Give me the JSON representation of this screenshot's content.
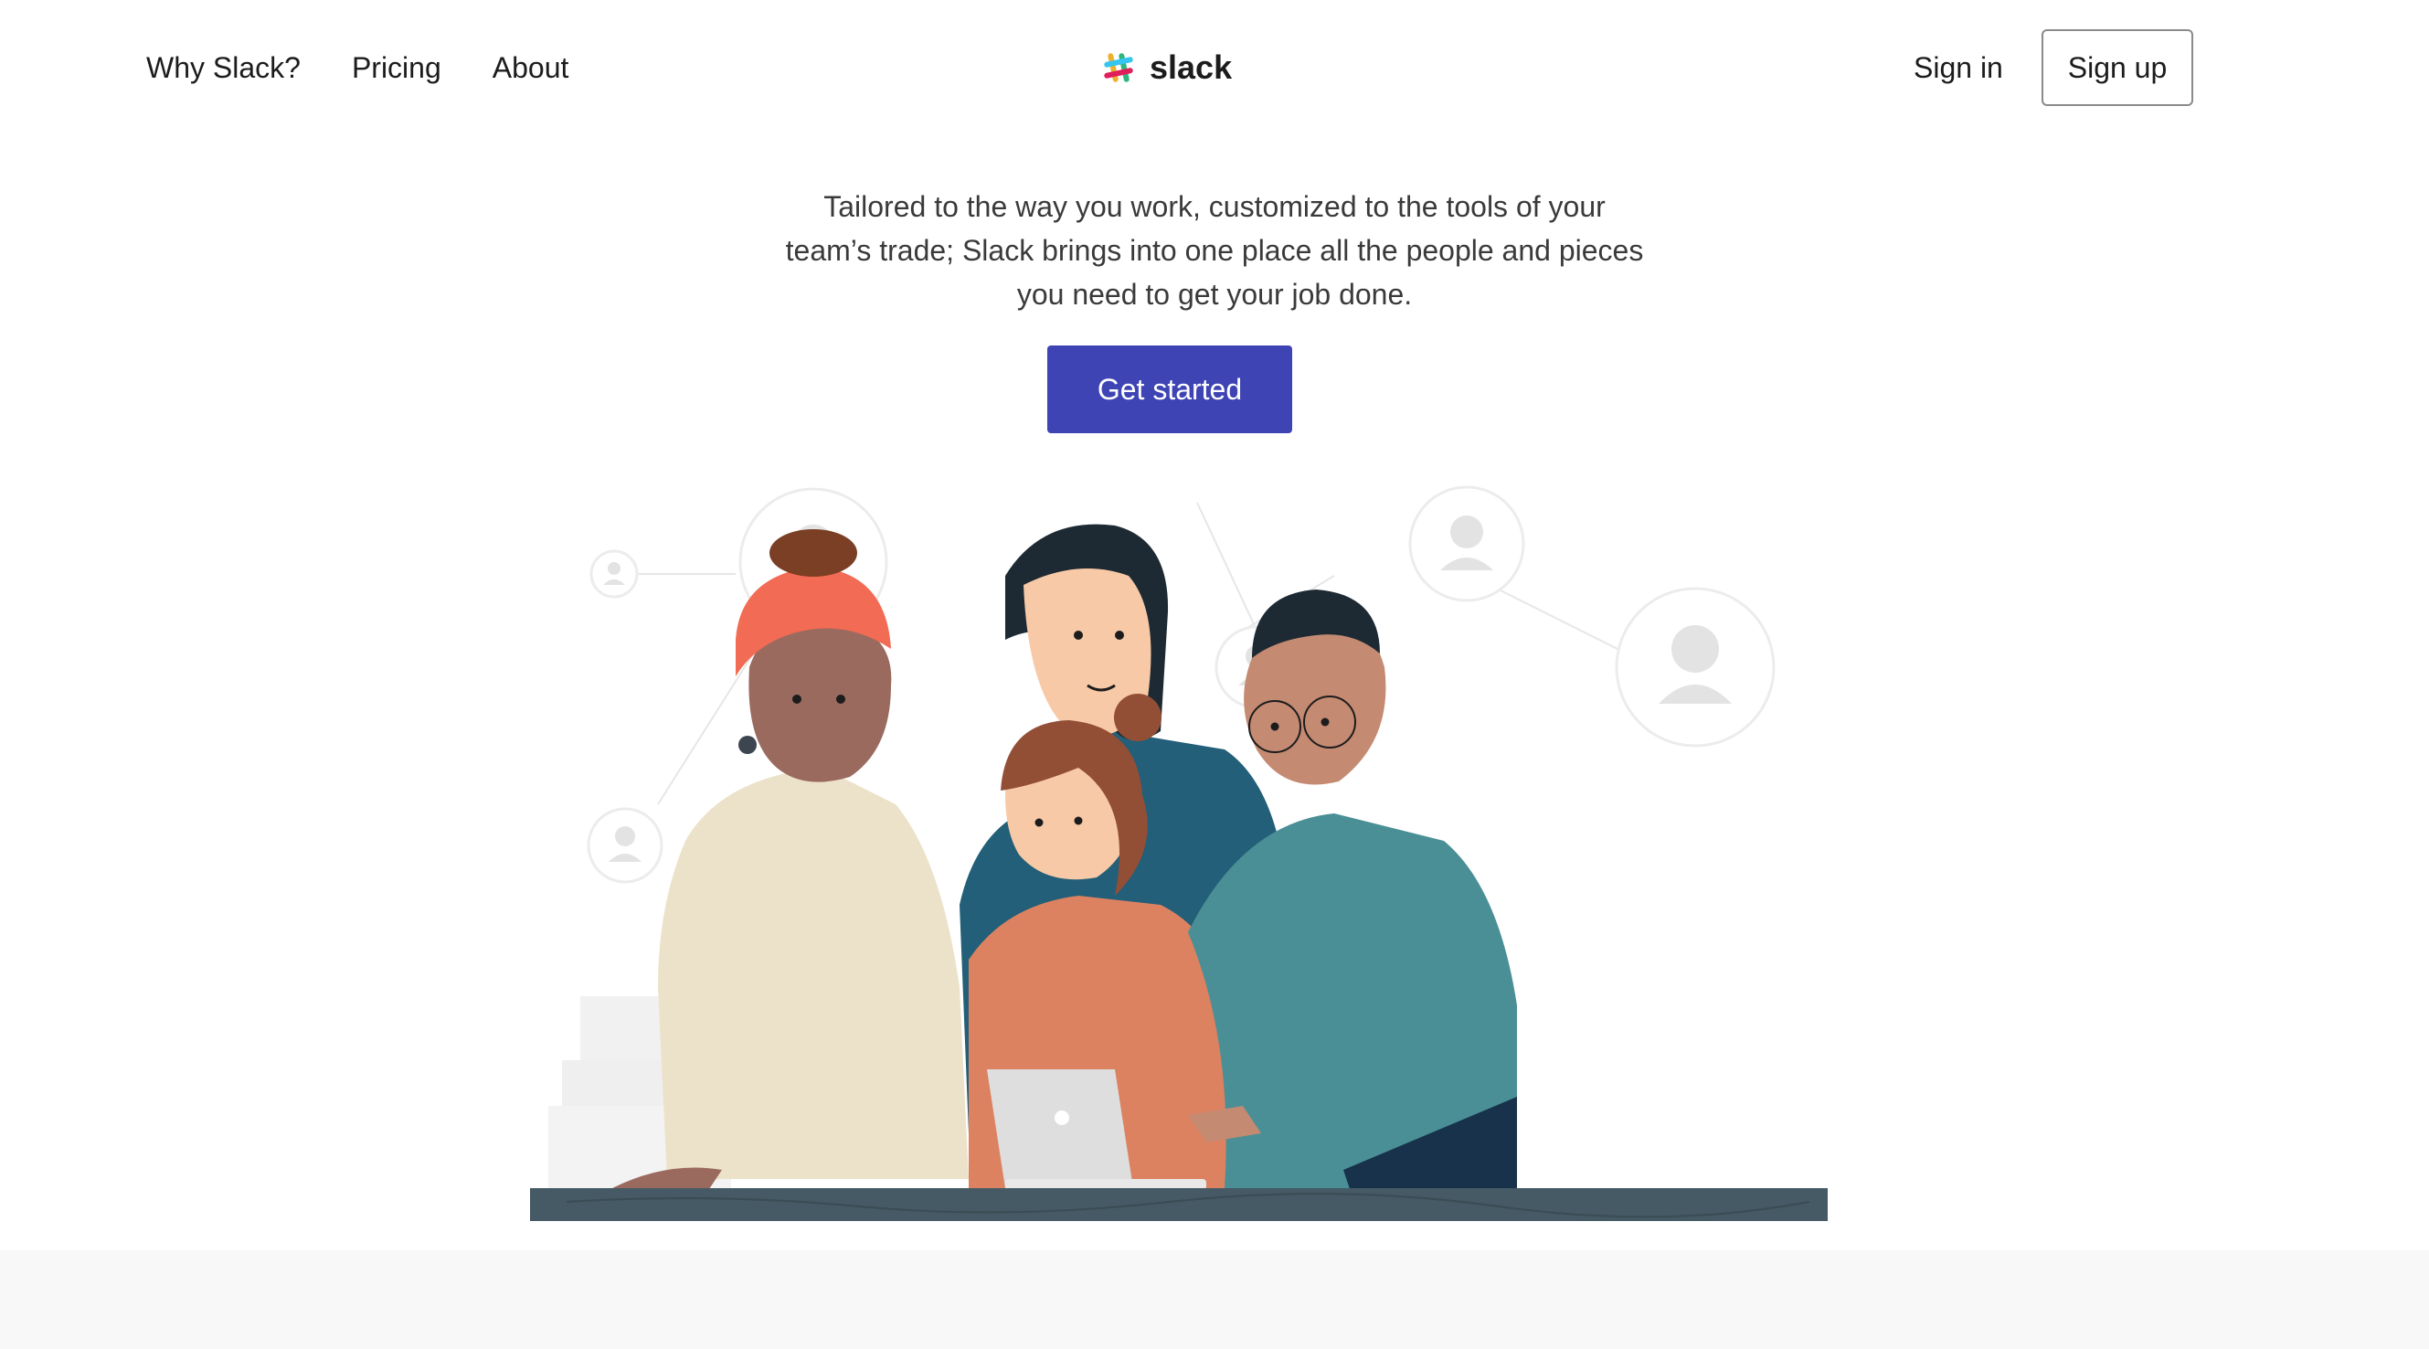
{
  "nav": {
    "links": [
      "Why Slack?",
      "Pricing",
      "About"
    ]
  },
  "brand": {
    "name": "slack",
    "logo_icon": "slack-hash-icon",
    "colors": [
      "#36c5f0",
      "#2eb67d",
      "#ecb22e",
      "#e01e5a"
    ]
  },
  "auth": {
    "sign_in": "Sign in",
    "sign_up": "Sign up"
  },
  "hero": {
    "line1": "Tailored to the way you work, customized to the tools of your",
    "line2": "team’s trade; Slack brings into one place all the people and pieces",
    "line3": "you need to get your job done.",
    "cta": "Get started",
    "cta_color": "#3f44b4"
  },
  "illustration": {
    "icon": "team-collaboration-illustration"
  }
}
